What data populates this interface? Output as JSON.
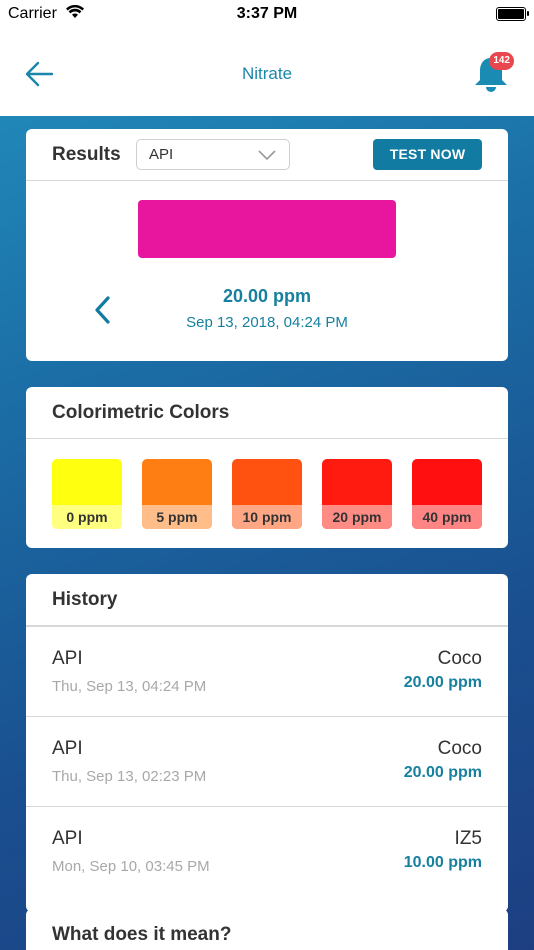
{
  "status_bar": {
    "carrier": "Carrier",
    "time": "3:37 PM"
  },
  "nav": {
    "title": "Nitrate",
    "notification_count": "142"
  },
  "results": {
    "title": "Results",
    "test_type": "API",
    "test_now_label": "TEST NOW",
    "result_color": "#e8159f",
    "reading": "20.00 ppm",
    "date": "Sep 13, 2018, 04:24 PM"
  },
  "colorimetric": {
    "title": "Colorimetric Colors",
    "items": [
      {
        "label": "0 ppm",
        "color": "#ffff10",
        "label_bg": "#ffff80"
      },
      {
        "label": "5 ppm",
        "color": "#ff7e14",
        "label_bg": "#ffbd8a"
      },
      {
        "label": "10 ppm",
        "color": "#ff5210",
        "label_bg": "#ffa784"
      },
      {
        "label": "20 ppm",
        "color": "#ff1b0f",
        "label_bg": "#ff8c84"
      },
      {
        "label": "40 ppm",
        "color": "#ff0f0f",
        "label_bg": "#ff8585"
      }
    ]
  },
  "history": {
    "title": "History",
    "rows": [
      {
        "name": "API",
        "date": "Thu, Sep 13, 04:24 PM",
        "location": "Coco",
        "value": "20.00 ppm"
      },
      {
        "name": "API",
        "date": "Thu, Sep 13, 02:23 PM",
        "location": "Coco",
        "value": "20.00 ppm"
      },
      {
        "name": "API",
        "date": "Mon, Sep 10, 03:45 PM",
        "location": "IZ5",
        "value": "10.00 ppm"
      }
    ]
  },
  "meaning": {
    "title": "What does it mean?"
  },
  "colors": {
    "accent": "#17809f",
    "button": "#127ba1",
    "badge": "#e8474d"
  }
}
